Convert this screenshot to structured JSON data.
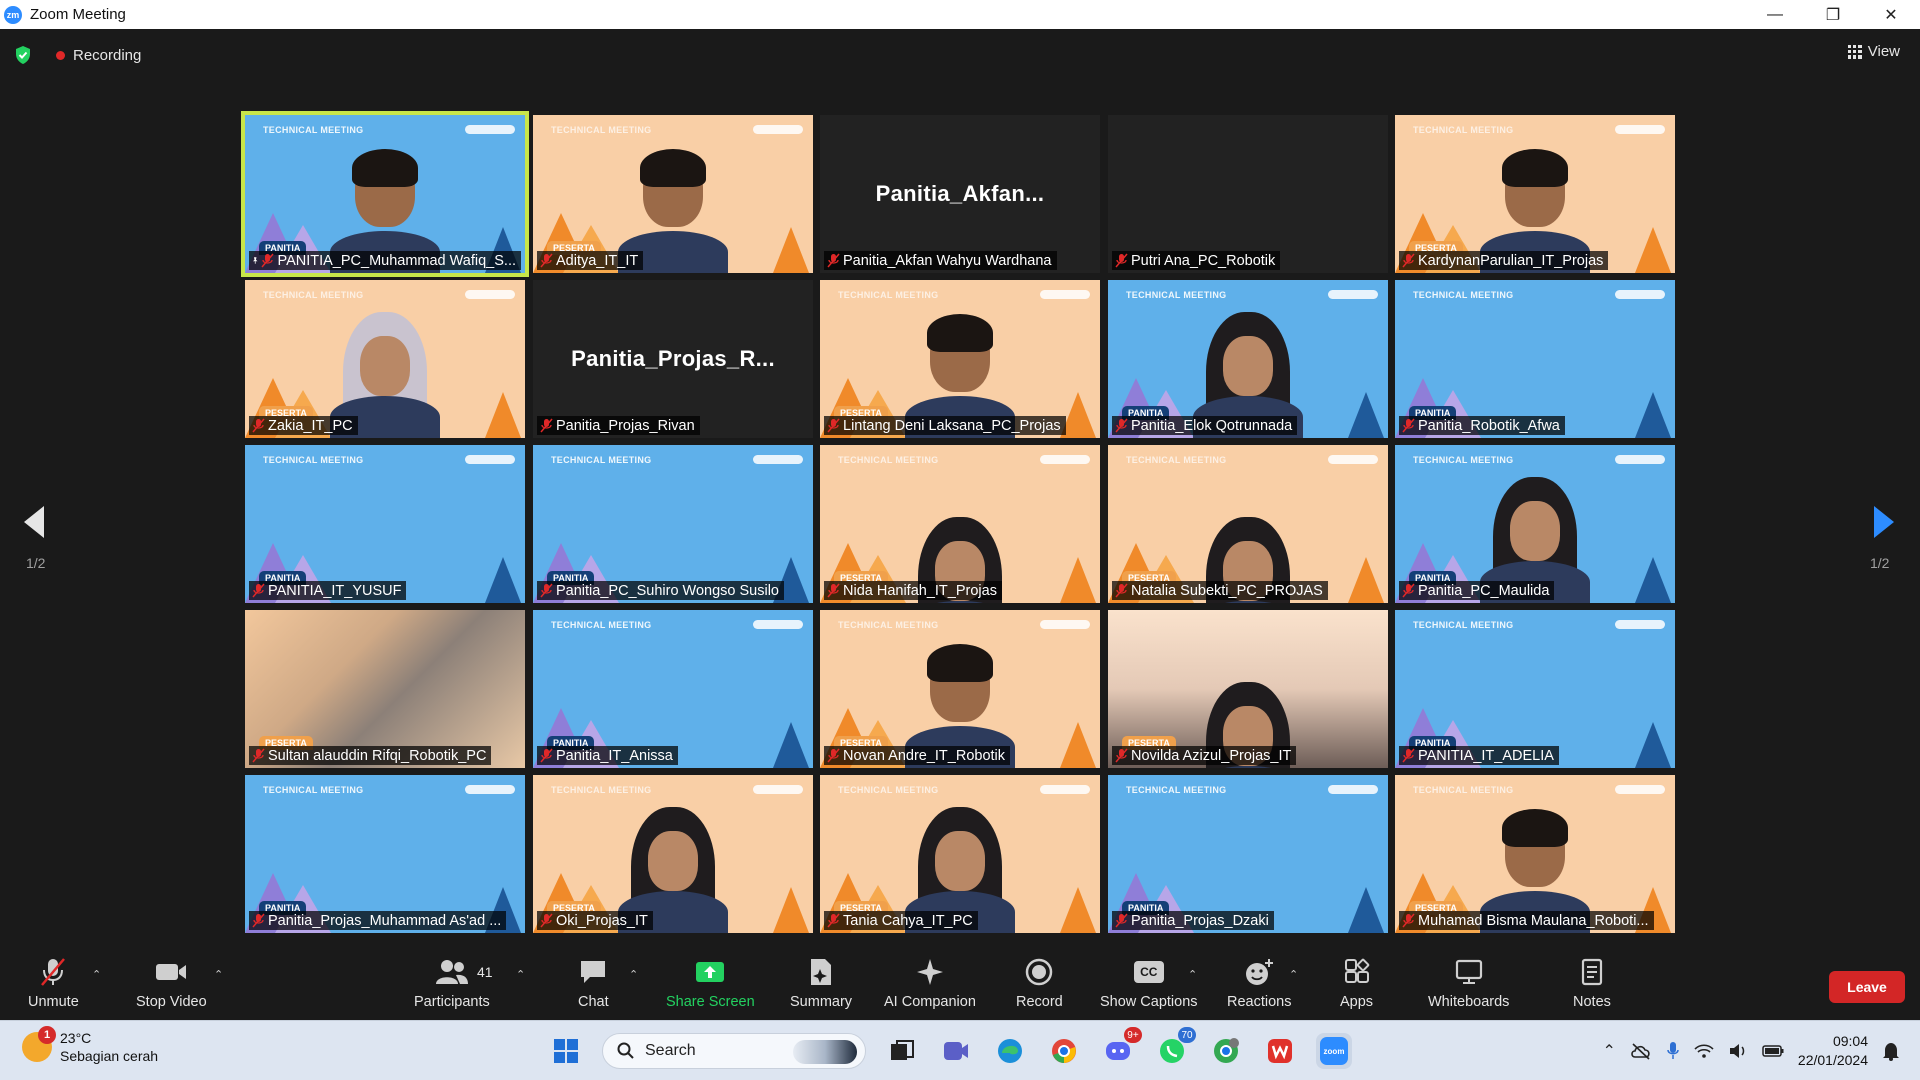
{
  "window": {
    "title": "Zoom Meeting",
    "logo_text": "zm"
  },
  "meeting_bar": {
    "recording_label": "Recording",
    "view_label": "View"
  },
  "pagination": {
    "left": "1/2",
    "right": "1/2"
  },
  "tiles": [
    {
      "name": "PANITIA_PC_Muhammad Wafiq_S...",
      "bg": "blue",
      "badge": "PANITIA",
      "person": "man",
      "pinned": true,
      "active": true
    },
    {
      "name": "Aditya_IT_IT",
      "bg": "orange",
      "badge": "PESERTA",
      "person": "man"
    },
    {
      "name": "Panitia_Akfan Wahyu Wardhana",
      "bg": "dark",
      "big": "Panitia_Akfan..."
    },
    {
      "name": "Putri Ana_PC_Robotik",
      "bg": "dark",
      "big": ""
    },
    {
      "name": "KardynanParulian_IT_Projas",
      "bg": "orange",
      "badge": "PESERTA",
      "person": "man"
    },
    {
      "name": "Zakia_IT_PC",
      "bg": "orange",
      "badge": "PESERTA",
      "person": "hijab-light"
    },
    {
      "name": "Panitia_Projas_Rivan",
      "bg": "dark",
      "big": "Panitia_Projas_R..."
    },
    {
      "name": "Lintang Deni Laksana_PC_Projas",
      "bg": "orange",
      "badge": "PESERTA",
      "person": "man"
    },
    {
      "name": "Panitia_Elok Qotrunnada",
      "bg": "blue",
      "badge": "PANITIA",
      "person": "hijab"
    },
    {
      "name": "Panitia_Robotik_Afwa",
      "bg": "blue",
      "badge": "PANITIA"
    },
    {
      "name": "PANITIA_IT_YUSUF",
      "bg": "blue",
      "badge": "PANITIA"
    },
    {
      "name": "Panitia_PC_Suhiro Wongso Susilo",
      "bg": "blue",
      "badge": "PANITIA"
    },
    {
      "name": "Nida Hanifah_IT_Projas",
      "bg": "orange",
      "badge": "PESERTA",
      "person": "hijab-low"
    },
    {
      "name": "Natalia Subekti_PC_PROJAS",
      "bg": "orange",
      "badge": "PESERTA",
      "person": "hijab-low"
    },
    {
      "name": "Panitia_PC_Maulida",
      "bg": "blue",
      "badge": "PANITIA",
      "person": "hijab"
    },
    {
      "name": "Sultan alauddin Rifqi_Robotik_PC",
      "bg": "photo",
      "badge": "PESERTA"
    },
    {
      "name": "Panitia_IT_Anissa",
      "bg": "blue",
      "badge": "PANITIA"
    },
    {
      "name": "Novan Andre_IT_Robotik",
      "bg": "orange",
      "badge": "PESERTA",
      "person": "man"
    },
    {
      "name": "Novilda Azizul_Projas_IT",
      "bg": "room",
      "badge": "PESERTA",
      "person": "hijab-low"
    },
    {
      "name": "PANITIA_IT_ADELIA",
      "bg": "blue",
      "badge": "PANITIA"
    },
    {
      "name": "Panitia_Projas_Muhammad As'ad ...",
      "bg": "blue",
      "badge": "PANITIA"
    },
    {
      "name": "Oki_Projas_IT",
      "bg": "orange",
      "badge": "PESERTA",
      "person": "hijab"
    },
    {
      "name": "Tania Cahya_IT_PC",
      "bg": "orange",
      "badge": "PESERTA",
      "person": "hijab"
    },
    {
      "name": "Panitia_Projas_Dzaki",
      "bg": "blue",
      "badge": "PANITIA"
    },
    {
      "name": "Muhamad Bisma Maulana_Roboti...",
      "bg": "orange",
      "badge": "PESERTA",
      "person": "man"
    }
  ],
  "tile_header": "TECHNICAL MEETING",
  "toolbar": {
    "unmute": "Unmute",
    "stop_video": "Stop Video",
    "participants": "Participants",
    "participants_count": "41",
    "chat": "Chat",
    "share_screen": "Share Screen",
    "summary": "Summary",
    "ai_companion": "AI Companion",
    "record": "Record",
    "captions": "Show Captions",
    "captions_icon_text": "CC",
    "reactions": "Reactions",
    "apps": "Apps",
    "whiteboards": "Whiteboards",
    "notes": "Notes",
    "leave": "Leave"
  },
  "taskbar": {
    "weather_temp": "23°C",
    "weather_desc": "Sebagian cerah",
    "weather_badge": "1",
    "search_placeholder": "Search",
    "discord_badge": "9+",
    "whatsapp_badge": "70",
    "time": "09:04",
    "date": "22/01/2024",
    "zoom_icon_text": "zoom"
  },
  "colors": {
    "accent_green": "#23d160",
    "leave_red": "#d32626",
    "active_speaker": "#c8e64a",
    "tile_blue": "#5fb0ea",
    "tile_orange": "#f9cfa6"
  }
}
